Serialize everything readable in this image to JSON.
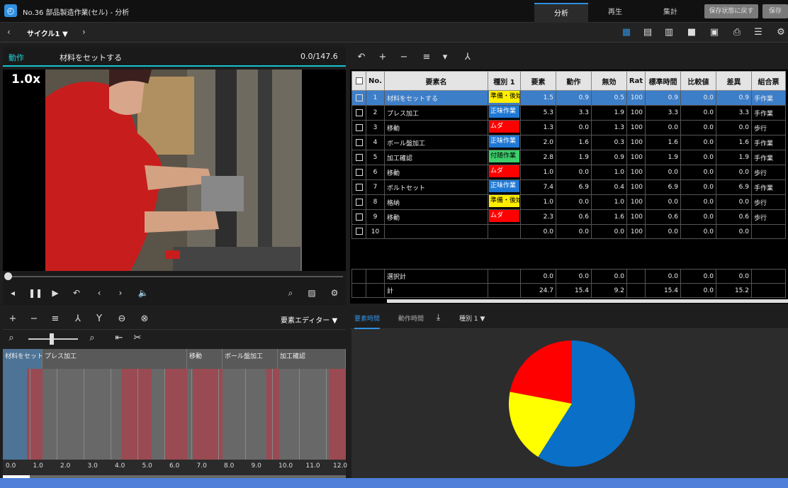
{
  "app": {
    "title": "No.36 部品製造作業(セル) - 分析",
    "tabs": [
      "分析",
      "再生",
      "集計"
    ],
    "restore_button": "保存状態に戻す",
    "save_button": "保存"
  },
  "toolbar": {
    "cycle_label": "サイクル1 ▼"
  },
  "video": {
    "header_label": "動作",
    "current_element": "材料をセットする",
    "time": "0.0/147.6",
    "speed": "1.0x"
  },
  "table": {
    "headers": [
      "No.",
      "要素名",
      "種別 1",
      "要素",
      "動作",
      "無効",
      "Rat",
      "標準時間",
      "比較値",
      "差異",
      "組合票"
    ],
    "rows": [
      {
        "no": "1",
        "name": "材料をセットする",
        "type": "準備・後始",
        "type_color": "#ffee00",
        "type_text": "#000",
        "el": "1.5",
        "mv": "0.9",
        "inv": "0.5",
        "rat": "100",
        "std": "0.9",
        "cmp": "0.0",
        "diff": "0.9",
        "combo": "手作業"
      },
      {
        "no": "2",
        "name": "プレス加工",
        "type": "正味作業",
        "type_color": "#1f78d4",
        "type_text": "#fff",
        "el": "5.3",
        "mv": "3.3",
        "inv": "1.9",
        "rat": "100",
        "std": "3.3",
        "cmp": "0.0",
        "diff": "3.3",
        "combo": "手作業"
      },
      {
        "no": "3",
        "name": "移動",
        "type": "ムダ",
        "type_color": "#ff0000",
        "type_text": "#fff",
        "el": "1.3",
        "mv": "0.0",
        "inv": "1.3",
        "rat": "100",
        "std": "0.0",
        "cmp": "0.0",
        "diff": "0.0",
        "combo": "歩行"
      },
      {
        "no": "4",
        "name": "ボール盤加工",
        "type": "正味作業",
        "type_color": "#1f78d4",
        "type_text": "#fff",
        "el": "2.0",
        "mv": "1.6",
        "inv": "0.3",
        "rat": "100",
        "std": "1.6",
        "cmp": "0.0",
        "diff": "1.6",
        "combo": "手作業"
      },
      {
        "no": "5",
        "name": "加工確認",
        "type": "付随作業",
        "type_color": "#3ccf6a",
        "type_text": "#000",
        "el": "2.8",
        "mv": "1.9",
        "inv": "0.9",
        "rat": "100",
        "std": "1.9",
        "cmp": "0.0",
        "diff": "1.9",
        "combo": "手作業"
      },
      {
        "no": "6",
        "name": "移動",
        "type": "ムダ",
        "type_color": "#ff0000",
        "type_text": "#fff",
        "el": "1.0",
        "mv": "0.0",
        "inv": "1.0",
        "rat": "100",
        "std": "0.0",
        "cmp": "0.0",
        "diff": "0.0",
        "combo": "歩行"
      },
      {
        "no": "7",
        "name": "ボルトセット",
        "type": "正味作業",
        "type_color": "#1f78d4",
        "type_text": "#fff",
        "el": "7.4",
        "mv": "6.9",
        "inv": "0.4",
        "rat": "100",
        "std": "6.9",
        "cmp": "0.0",
        "diff": "6.9",
        "combo": "手作業"
      },
      {
        "no": "8",
        "name": "格納",
        "type": "準備・後始",
        "type_color": "#ffee00",
        "type_text": "#000",
        "el": "1.0",
        "mv": "0.0",
        "inv": "1.0",
        "rat": "100",
        "std": "0.0",
        "cmp": "0.0",
        "diff": "0.0",
        "combo": "歩行"
      },
      {
        "no": "9",
        "name": "移動",
        "type": "ムダ",
        "type_color": "#ff0000",
        "type_text": "#fff",
        "el": "2.3",
        "mv": "0.6",
        "inv": "1.6",
        "rat": "100",
        "std": "0.6",
        "cmp": "0.0",
        "diff": "0.6",
        "combo": "歩行"
      },
      {
        "no": "10",
        "name": "",
        "type": "",
        "type_color": "",
        "type_text": "#fff",
        "el": "0.0",
        "mv": "0.0",
        "inv": "0.0",
        "rat": "100",
        "std": "0.0",
        "cmp": "0.0",
        "diff": "0.0",
        "combo": ""
      }
    ],
    "summary": [
      {
        "label": "選択計",
        "el": "0.0",
        "mv": "0.0",
        "inv": "0.0",
        "std": "0.0",
        "cmp": "0.0",
        "diff": "0.0"
      },
      {
        "label": "計",
        "el": "24.7",
        "mv": "15.4",
        "inv": "9.2",
        "std": "15.4",
        "cmp": "0.0",
        "diff": "15.2"
      }
    ]
  },
  "editor": {
    "title": "要素エディター ▼",
    "segments": [
      {
        "label": "材料をセットする"
      },
      {
        "label": "プレス加工"
      },
      {
        "label": "移動"
      },
      {
        "label": "ボール盤加工"
      },
      {
        "label": "加工確認"
      }
    ],
    "ticks": [
      "0.0",
      "1.0",
      "2.0",
      "3.0",
      "4.0",
      "5.0",
      "6.0",
      "7.0",
      "8.0",
      "9.0",
      "10.0",
      "11.0",
      "12.0"
    ]
  },
  "chart_tabs": [
    "要素時間",
    "動作時間",
    "種別 1 ▼"
  ],
  "chart_data": {
    "type": "pie",
    "slices": [
      {
        "name": "正味作業",
        "value": 0.59,
        "color": "#0a6fc6"
      },
      {
        "name": "準備・後始",
        "value": 0.19,
        "color": "#ffff00"
      },
      {
        "name": "ムダ",
        "value": 0.22,
        "color": "#ff0000"
      }
    ]
  }
}
